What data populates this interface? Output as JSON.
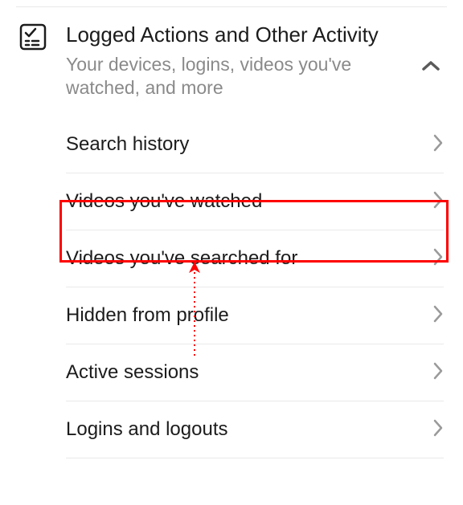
{
  "section": {
    "title": "Logged Actions and Other Activity",
    "subtitle": "Your devices, logins, videos you've watched, and more"
  },
  "items": [
    {
      "label": "Search history"
    },
    {
      "label": "Videos you've watched"
    },
    {
      "label": "Videos you've searched for"
    },
    {
      "label": "Hidden from profile"
    },
    {
      "label": "Active sessions"
    },
    {
      "label": "Logins and logouts"
    }
  ]
}
